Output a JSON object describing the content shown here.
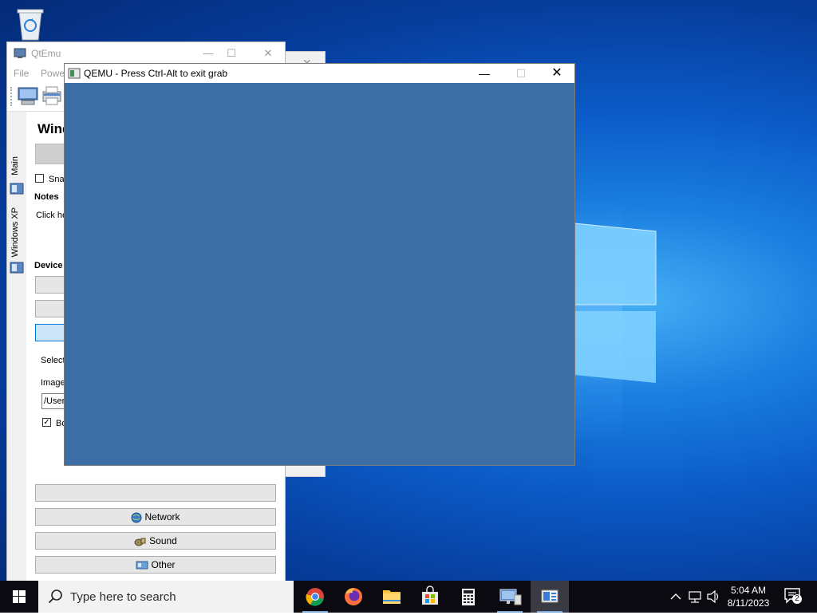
{
  "desktop": {
    "recycle_bin_icon": "recycle-bin-icon",
    "logo": "windows-logo"
  },
  "qtemu": {
    "title": "QtEmu",
    "menu": [
      "File",
      "Power"
    ],
    "tabs": [
      {
        "label": "Main"
      },
      {
        "label": "Windows XP"
      }
    ],
    "vm_name": "Wind",
    "snapshot_label": "Snap",
    "notes_heading": "Notes",
    "notes_text": "Click he",
    "devices_heading": "Device",
    "select_label": "Select",
    "image_label": "Image",
    "image_path": "/Users",
    "boot_label": "Bo",
    "boot_checked": true,
    "device_buttons": [
      {
        "label": "Network",
        "icon": "network-globe-icon"
      },
      {
        "label": "Sound",
        "icon": "sound-speaker-icon"
      },
      {
        "label": "Other",
        "icon": "other-device-icon"
      }
    ]
  },
  "qemu": {
    "title": "QEMU - Press Ctrl-Alt to exit grab",
    "screen_color": "#3d6ea5"
  },
  "taskbar": {
    "search_placeholder": "Type here to search",
    "apps": [
      "chrome",
      "firefox",
      "file-explorer",
      "microsoft-store",
      "calculator",
      "remote-desktop",
      "qemu-window"
    ],
    "time": "5:04 AM",
    "date": "8/11/2023",
    "notification_count": "2"
  }
}
